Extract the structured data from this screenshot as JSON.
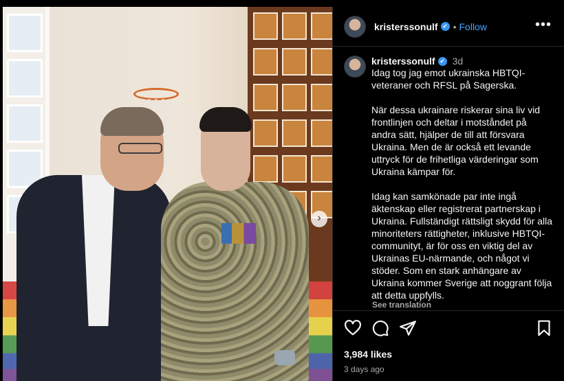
{
  "post": {
    "username": "kristerssonulf",
    "verified_mark": "✔",
    "follow_label": "Follow",
    "more_label": "•••",
    "separator": "•"
  },
  "caption": {
    "time": "3d",
    "text": "Idag tog jag emot ukrainska HBTQI-veteraner och RFSL på Sagerska.\n\nNär dessa ukrainare riskerar sina liv vid frontlinjen och deltar i motståndet på andra sätt, hjälper de till att försvara Ukraina. Men de är också ett levande uttryck för de frihetliga värderingar som Ukraina kämpar för.\n\nIdag kan samkönade par inte ingå äktenskap eller registrerat partnerskap i Ukraina. Fullständigt rättsligt skydd för alla minoriteters rättigheter, inklusive HBTQI-communityt, är för oss en viktig del av Ukrainas EU-närmande, och något vi stöder. Som en stark anhängare av Ukraina kommer Sverige att noggrant följa att detta uppfylls.",
    "see_translation": "See translation"
  },
  "stats": {
    "likes": "3,984 likes",
    "date": "3 days ago"
  },
  "media": {
    "next_glyph": "›"
  },
  "icons": {
    "like": "heart-icon",
    "comment": "comment-icon",
    "share": "share-icon",
    "save": "bookmark-icon",
    "more": "more-options-icon",
    "next": "chevron-right-icon"
  },
  "colors": {
    "background": "#000000",
    "text": "#f5f5f5",
    "muted": "#a8a8a8",
    "accent": "#4aa3ff",
    "verified": "#3897f0",
    "divider": "#262626"
  }
}
